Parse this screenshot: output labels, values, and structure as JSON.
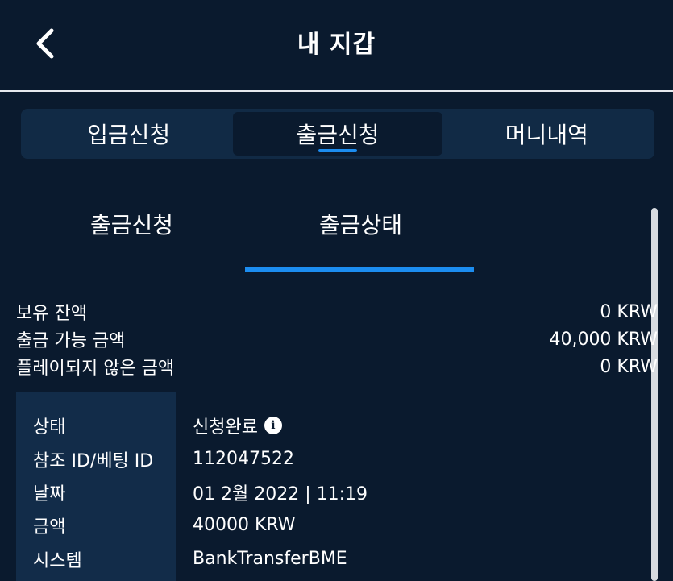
{
  "header": {
    "title": "내 지갑"
  },
  "main_tabs": [
    {
      "label": "입금신청"
    },
    {
      "label": "출금신청"
    },
    {
      "label": "머니내역"
    }
  ],
  "active_main_tab": "출금신청",
  "sub_tabs": [
    {
      "label": "출금신청"
    },
    {
      "label": "출금상태"
    }
  ],
  "active_sub_tab": "출금상태",
  "balances": [
    {
      "label": "보유 잔액",
      "value": "0 KRW"
    },
    {
      "label": "출금 가능 금액",
      "value": "40,000 KRW"
    },
    {
      "label": "플레이되지 않은 금액",
      "value": "0 KRW"
    }
  ],
  "status": {
    "rows": [
      {
        "label": "상태",
        "value": "신청완료"
      },
      {
        "label": "참조 ID/베팅 ID",
        "value": "112047522"
      },
      {
        "label": "날짜",
        "value": "01 2월 2022 | 11:19"
      },
      {
        "label": "금액",
        "value": "40000 KRW"
      },
      {
        "label": "시스템",
        "value": "BankTransferBME"
      }
    ]
  },
  "colors": {
    "background": "#0a1a2e",
    "tab_bar": "#112a45",
    "accent": "#1c8df0",
    "label_column": "#122c49"
  },
  "icons": {
    "back": "chevron-left-icon",
    "info": "info-icon"
  }
}
